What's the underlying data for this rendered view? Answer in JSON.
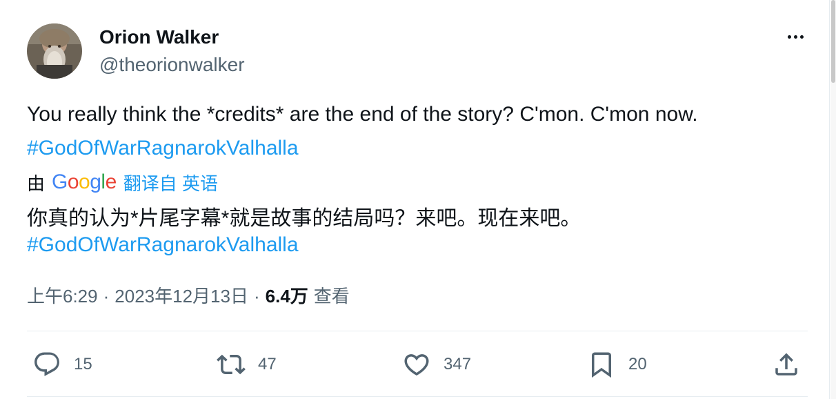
{
  "author": {
    "name": "Orion Walker",
    "handle": "@theorionwalker",
    "avatar_icon": "user-avatar-photo"
  },
  "tweet": {
    "text": "You really think the *credits* are the end of the story? C'mon. C'mon now.",
    "hashtag": "#GodOfWarRagnarokValhalla"
  },
  "translation": {
    "by_label": "由",
    "provider": "Google",
    "translated_from": "翻译自 英语",
    "text": "你真的认为*片尾字幕*就是故事的结局吗？来吧。现在来吧。",
    "hashtag": "#GodOfWarRagnarokValhalla"
  },
  "meta": {
    "time": "上午6:29",
    "separator": "·",
    "date": "2023年12月13日",
    "views_count": "6.4万",
    "views_label": "查看"
  },
  "actions": {
    "reply": {
      "icon": "reply-icon",
      "count": "15"
    },
    "retweet": {
      "icon": "retweet-icon",
      "count": "47"
    },
    "like": {
      "icon": "heart-icon",
      "count": "347"
    },
    "bookmark": {
      "icon": "bookmark-icon",
      "count": "20"
    },
    "share": {
      "icon": "share-icon"
    }
  },
  "colors": {
    "accent": "#1d9bf0",
    "text_primary": "#0f1419",
    "text_secondary": "#536471",
    "divider": "#e6ecf0"
  }
}
